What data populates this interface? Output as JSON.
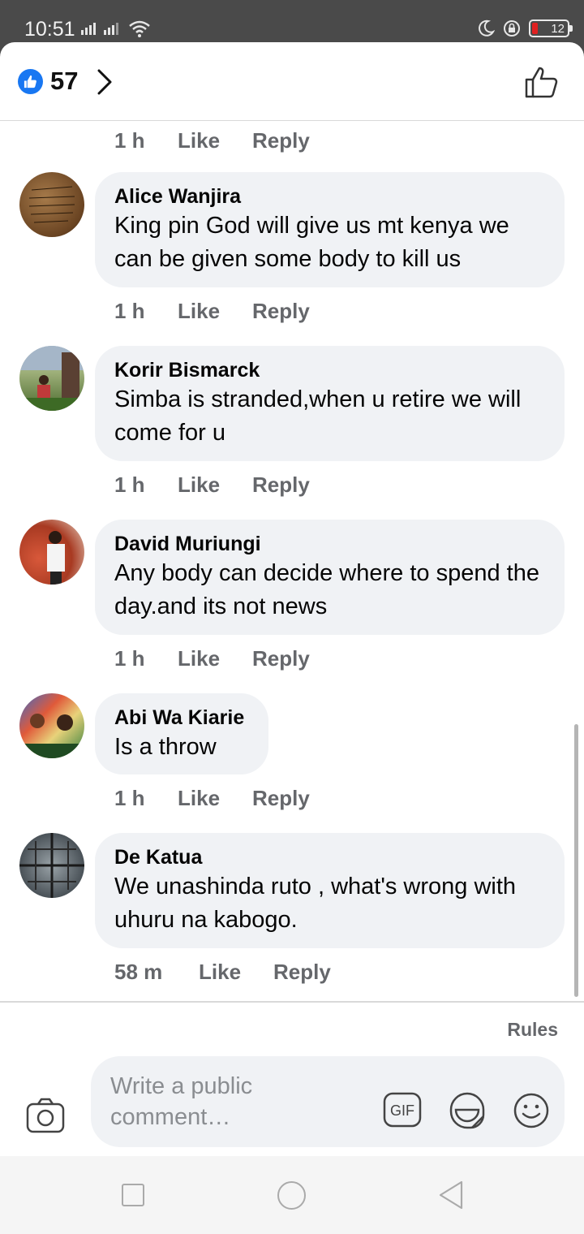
{
  "status_bar": {
    "time": "10:51",
    "battery": "12"
  },
  "header": {
    "reaction_count": "57"
  },
  "comments": [
    {
      "name": "",
      "text": "",
      "time": "1 h",
      "like": "Like",
      "reply": "Reply"
    },
    {
      "name": "Alice Wanjira",
      "text": "King pin God will give us mt kenya we can be given some body to kill us",
      "time": "1 h",
      "like": "Like",
      "reply": "Reply"
    },
    {
      "name": "Korir Bismarck",
      "text": "Simba is stranded,when u retire we will come for u",
      "time": "1 h",
      "like": "Like",
      "reply": "Reply"
    },
    {
      "name": "David Muriungi",
      "text": "Any body can decide where to spend the day.and its not news",
      "time": "1 h",
      "like": "Like",
      "reply": "Reply"
    },
    {
      "name": "Abi Wa Kiarie",
      "text": "Is a throw",
      "time": "1 h",
      "like": "Like",
      "reply": "Reply"
    },
    {
      "name": "De Katua",
      "text": "We unashinda ruto , what's wrong with uhuru na kabogo.",
      "time": "58 m",
      "like": "Like",
      "reply": "Reply"
    }
  ],
  "composer": {
    "rules": "Rules",
    "placeholder": "Write a public comment…",
    "gif": "GIF"
  },
  "colors": {
    "brand": "#1877f2",
    "bubble": "#f0f2f5",
    "meta": "#65676b"
  }
}
